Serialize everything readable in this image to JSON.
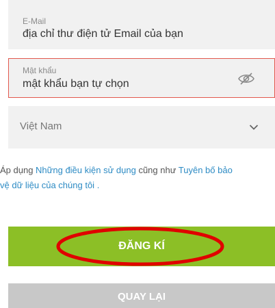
{
  "form": {
    "email": {
      "label": "E-Mail",
      "value": "địa chỉ thư điện tử Email của bạn"
    },
    "password": {
      "label": "Mật khẩu",
      "value": "mật khẩu bạn tự chọn",
      "icon": "eye-slash-icon",
      "border_color": "#e2574c"
    },
    "country": {
      "selected": "Việt Nam",
      "icon": "chevron-down-icon"
    }
  },
  "terms": {
    "prefix": "Áp dụng ",
    "link1": "Những điều kiện sử dụng",
    "middle": " cũng như ",
    "link2_part1": "Tuyên bố bảo",
    "link2_part2": "vệ dữ liệu của chúng tôi",
    "suffix": " .",
    "link_color": "#2d8bc4"
  },
  "buttons": {
    "register": {
      "label": "ĐĂNG KÍ",
      "color": "#8cbf26"
    },
    "back": {
      "label": "QUAY LẠI",
      "color": "#c8c8c8"
    }
  },
  "annotation": {
    "shape": "ellipse",
    "color": "#e00000"
  }
}
